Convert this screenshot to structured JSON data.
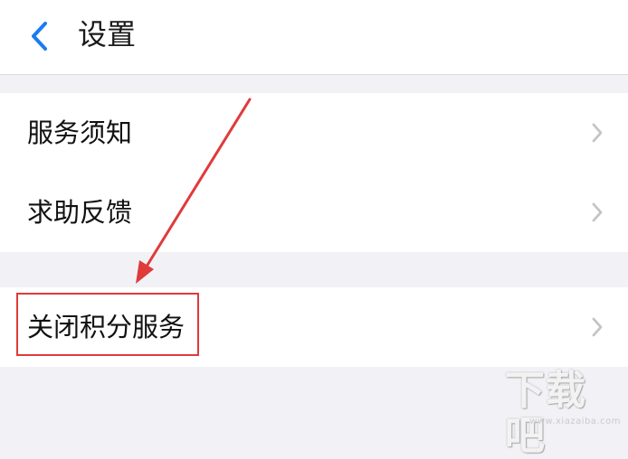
{
  "header": {
    "title": "设置",
    "back_icon": "chevron-left-icon",
    "accent_color": "#1a7cf0"
  },
  "groups": [
    {
      "items": [
        {
          "label": "服务须知",
          "icon": "chevron-right-icon"
        },
        {
          "label": "求助反馈",
          "icon": "chevron-right-icon"
        }
      ]
    },
    {
      "items": [
        {
          "label": "关闭积分服务",
          "icon": "chevron-right-icon"
        }
      ]
    }
  ],
  "annotation": {
    "color": "#e03a3a"
  },
  "watermark": {
    "text": "下载吧",
    "url": "www.xiazaiba.com"
  }
}
